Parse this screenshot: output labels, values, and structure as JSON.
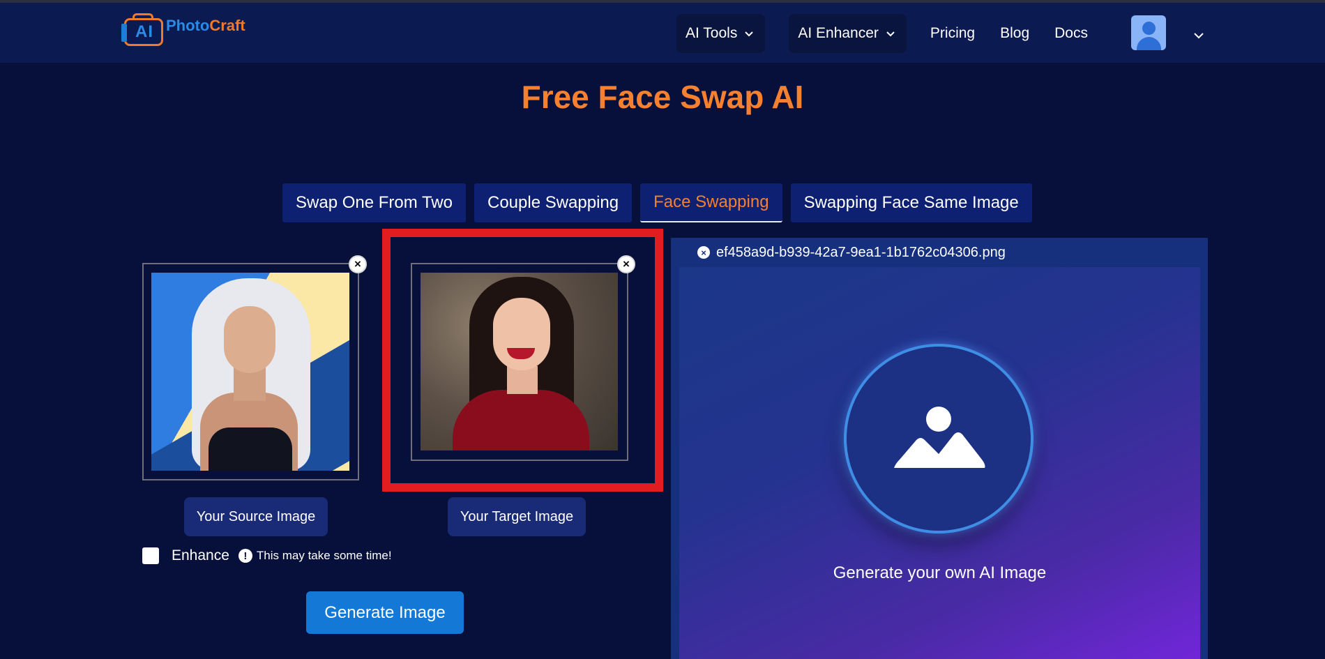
{
  "brand": {
    "logo_ai": "AI",
    "logo_part1": "Photo",
    "logo_part2": "Craft"
  },
  "nav": {
    "ai_tools": "AI Tools",
    "ai_enhancer": "AI Enhancer",
    "pricing": "Pricing",
    "blog": "Blog",
    "docs": "Docs"
  },
  "page": {
    "title": "Free Face Swap AI"
  },
  "tabs": [
    {
      "label": "Swap One From Two",
      "active": false
    },
    {
      "label": "Couple Swapping",
      "active": false
    },
    {
      "label": "Face Swapping",
      "active": true
    },
    {
      "label": "Swapping Face Same Image",
      "active": false
    }
  ],
  "source": {
    "label": "Your Source Image"
  },
  "target": {
    "label": "Your Target Image"
  },
  "options": {
    "enhance_label": "Enhance",
    "enhance_checked": false,
    "info_text": "This may take some time!"
  },
  "actions": {
    "generate_label": "Generate Image"
  },
  "result": {
    "file_name": "ef458a9d-b939-42a7-9ea1-1b1762c04306.png",
    "placeholder_text": "Generate your own AI Image"
  },
  "colors": {
    "background": "#070f3b",
    "header": "#0c1a52",
    "accent_orange": "#f5802f",
    "primary_blue": "#1479d6",
    "highlight_red": "#e21d1f"
  }
}
